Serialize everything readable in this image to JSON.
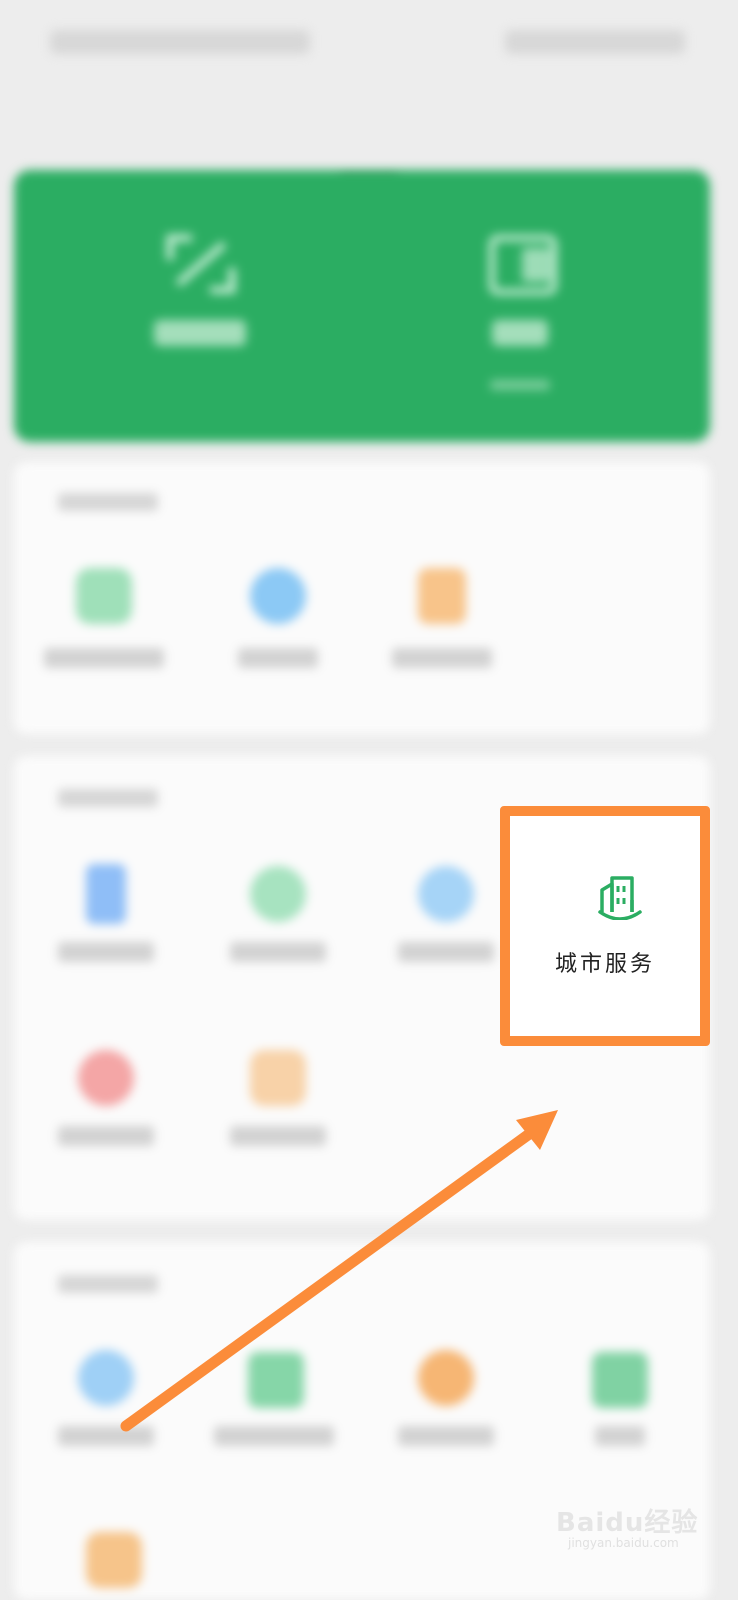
{
  "city_service": {
    "label": "城市服务"
  },
  "watermark": {
    "brand": "Baidu经验",
    "url": "jingyan.baidu.com"
  },
  "icons": {
    "back": "chevron-left-icon",
    "more": "ellipsis-icon",
    "receive_payment": "scan-qr-icon",
    "wallet": "wallet-icon",
    "city_service": "city-buildings-icon"
  },
  "colors": {
    "brand_green": "#2bad62",
    "highlight_orange": "#fb8c3a",
    "background": "#ededed"
  }
}
